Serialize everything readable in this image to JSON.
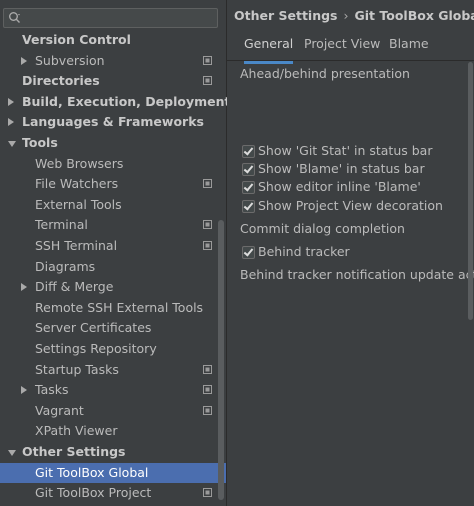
{
  "search": {
    "placeholder": ""
  },
  "tree": [
    {
      "label": "Version Control",
      "level": 0,
      "bold": true,
      "arrow": "none",
      "project": false
    },
    {
      "label": "Subversion",
      "level": 1,
      "bold": false,
      "arrow": "right",
      "project": true
    },
    {
      "label": "Directories",
      "level": 0,
      "bold": true,
      "arrow": "none",
      "project": true
    },
    {
      "label": "Build, Execution, Deployment",
      "level": 0,
      "bold": true,
      "arrow": "right",
      "project": false
    },
    {
      "label": "Languages & Frameworks",
      "level": 0,
      "bold": true,
      "arrow": "right",
      "project": false
    },
    {
      "label": "Tools",
      "level": 0,
      "bold": true,
      "arrow": "down",
      "project": false
    },
    {
      "label": "Web Browsers",
      "level": 1,
      "bold": false,
      "arrow": "none",
      "project": false
    },
    {
      "label": "File Watchers",
      "level": 1,
      "bold": false,
      "arrow": "none",
      "project": true
    },
    {
      "label": "External Tools",
      "level": 1,
      "bold": false,
      "arrow": "none",
      "project": false
    },
    {
      "label": "Terminal",
      "level": 1,
      "bold": false,
      "arrow": "none",
      "project": true
    },
    {
      "label": "SSH Terminal",
      "level": 1,
      "bold": false,
      "arrow": "none",
      "project": true
    },
    {
      "label": "Diagrams",
      "level": 1,
      "bold": false,
      "arrow": "none",
      "project": false
    },
    {
      "label": "Diff & Merge",
      "level": 1,
      "bold": false,
      "arrow": "right",
      "project": false
    },
    {
      "label": "Remote SSH External Tools",
      "level": 1,
      "bold": false,
      "arrow": "none",
      "project": false
    },
    {
      "label": "Server Certificates",
      "level": 1,
      "bold": false,
      "arrow": "none",
      "project": false
    },
    {
      "label": "Settings Repository",
      "level": 1,
      "bold": false,
      "arrow": "none",
      "project": false
    },
    {
      "label": "Startup Tasks",
      "level": 1,
      "bold": false,
      "arrow": "none",
      "project": true
    },
    {
      "label": "Tasks",
      "level": 1,
      "bold": false,
      "arrow": "right",
      "project": true
    },
    {
      "label": "Vagrant",
      "level": 1,
      "bold": false,
      "arrow": "none",
      "project": true
    },
    {
      "label": "XPath Viewer",
      "level": 1,
      "bold": false,
      "arrow": "none",
      "project": false
    },
    {
      "label": "Other Settings",
      "level": 0,
      "bold": true,
      "arrow": "down",
      "project": false
    },
    {
      "label": "Git ToolBox Global",
      "level": 1,
      "bold": false,
      "arrow": "none",
      "project": false,
      "selected": true
    },
    {
      "label": "Git ToolBox Project",
      "level": 1,
      "bold": false,
      "arrow": "none",
      "project": true
    }
  ],
  "breadcrumb": {
    "parent": "Other Settings",
    "separator": "›",
    "current": "Git ToolBox Global"
  },
  "tabs": [
    {
      "label": "General",
      "active": true
    },
    {
      "label": "Project View",
      "active": false
    },
    {
      "label": "Blame",
      "active": false
    }
  ],
  "content": {
    "ahead_behind": "Ahead/behind presentation",
    "checks_top": [
      {
        "label": "Show 'Git Stat' in status bar",
        "checked": true
      },
      {
        "label": "Show 'Blame' in status bar",
        "checked": true
      },
      {
        "label": "Show editor inline 'Blame'",
        "checked": true
      },
      {
        "label": "Show Project View decoration",
        "checked": true
      }
    ],
    "commit_dialog": "Commit dialog completion",
    "behind_tracker": {
      "label": "Behind tracker",
      "checked": true
    },
    "behind_tracker_notification": "Behind tracker notification update action"
  },
  "colors": {
    "background": "#3c3f41",
    "selection": "#4b6eaf",
    "tab_accent": "#4a88c7"
  }
}
